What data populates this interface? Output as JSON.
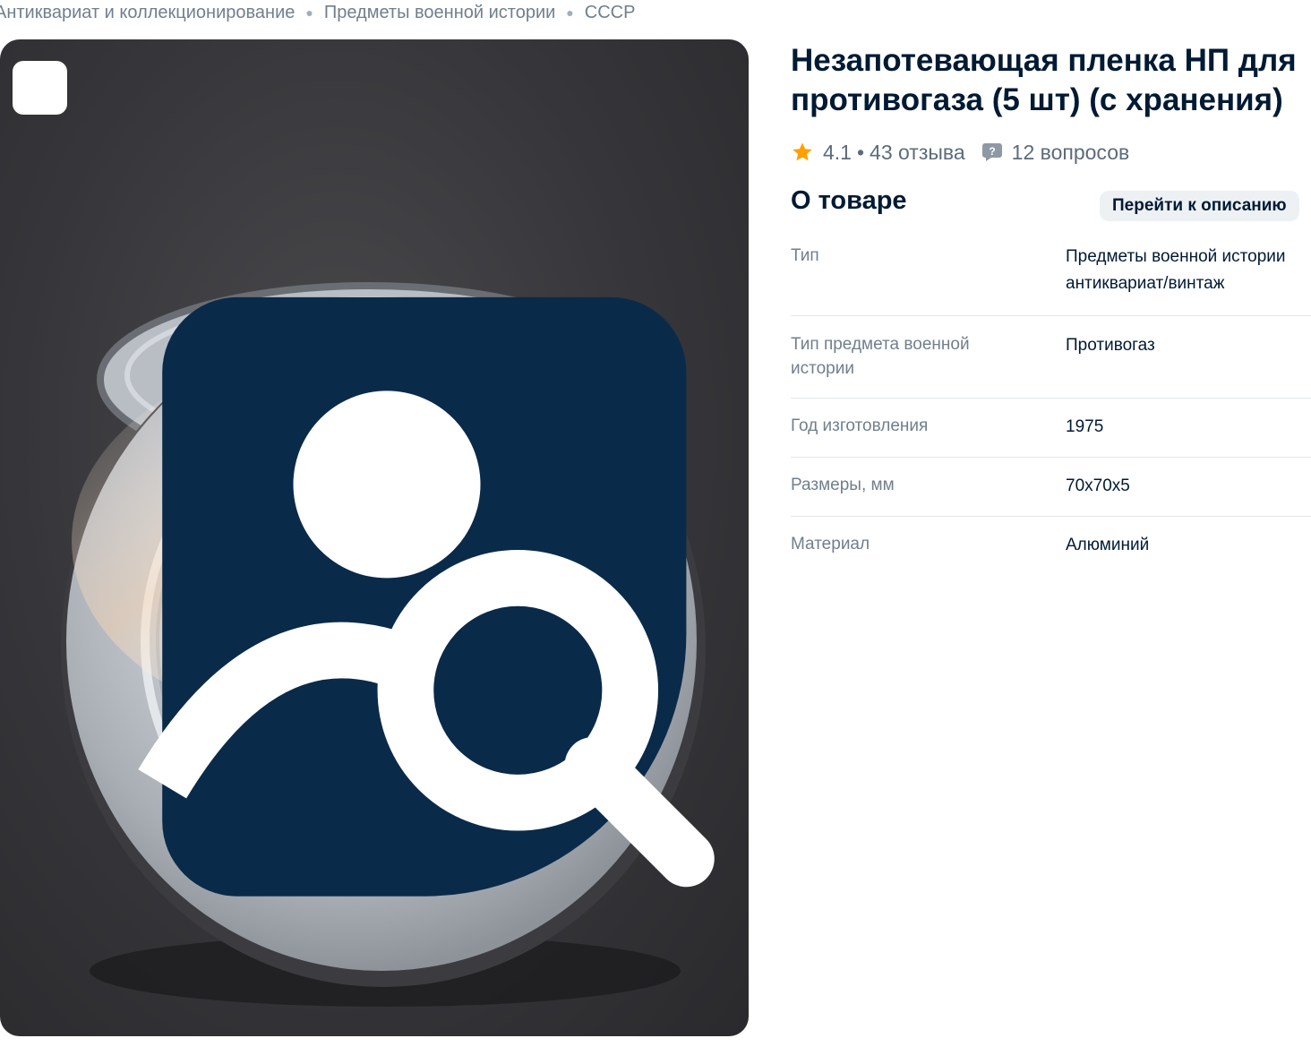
{
  "breadcrumbs": [
    "Антиквариат и коллекционирование",
    "Предметы военной истории",
    "СССР"
  ],
  "product": {
    "title_line1": "Незапотевающая пленка НП для",
    "title_line2": "противогаза (5 шт) (с хранения)",
    "image_icon": "image-search-icon"
  },
  "rating": {
    "value": "4.1",
    "separator": "•",
    "reviews": "43 отзыва",
    "questions": "12 вопросов",
    "star_color": "#ffa000"
  },
  "about": {
    "title": "О товаре",
    "goto_label": "Перейти к описанию"
  },
  "specs": [
    {
      "key": "Тип",
      "value": [
        "Предметы военной истории",
        "антиквариат/винтаж"
      ]
    },
    {
      "key": "Тип предмета военной истории",
      "value": [
        "Противогаз"
      ]
    },
    {
      "key": "Год изготовления",
      "value": [
        "1975"
      ]
    },
    {
      "key": "Размеры, мм",
      "value": [
        "70x70x5"
      ]
    },
    {
      "key": "Материал",
      "value": [
        "Алюминий"
      ]
    }
  ],
  "colors": {
    "text_primary": "#001a34",
    "text_secondary": "#707f8d",
    "accent_star": "#ffa000",
    "icon_dark": "#0a2a4a"
  }
}
